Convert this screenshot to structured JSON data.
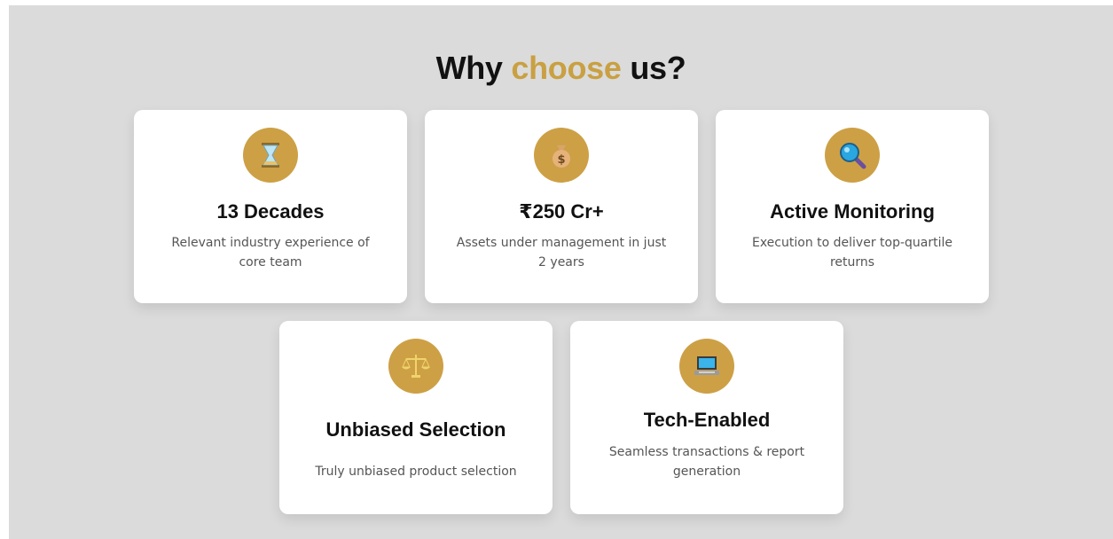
{
  "section": {
    "heading_prefix": "Why",
    "heading_accent": "choose",
    "heading_suffix": "us?"
  },
  "colors": {
    "accent": "#c9a042",
    "icon_bg": "#cda046",
    "section_bg": "#dbdbdb"
  },
  "cards": [
    {
      "icon": "hourglass-icon",
      "title": "13 Decades",
      "description": "Relevant industry experience of core team"
    },
    {
      "icon": "money-bag-icon",
      "title": "₹250 Cr+",
      "description": "Assets under management in just 2 years"
    },
    {
      "icon": "magnifier-icon",
      "title": "Active Monitoring",
      "description": "Execution to deliver top-quartile returns"
    },
    {
      "icon": "balance-scale-icon",
      "title": "Unbiased Selection",
      "description": "Truly unbiased product selection"
    },
    {
      "icon": "laptop-icon",
      "title": "Tech-Enabled",
      "description": "Seamless transactions & report generation"
    }
  ]
}
